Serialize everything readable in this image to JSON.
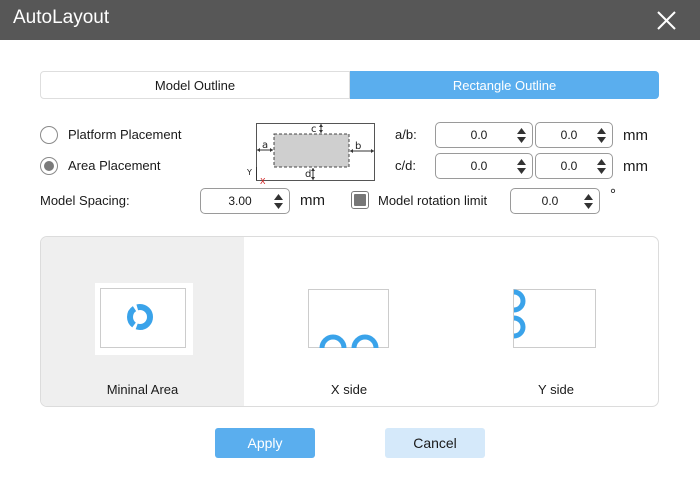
{
  "window": {
    "title": "AutoLayout"
  },
  "tabs": [
    {
      "label": "Model Outline",
      "selected": false
    },
    {
      "label": "Rectangle Outline",
      "selected": true
    }
  ],
  "placement": {
    "platform_label": "Platform Placement",
    "area_label": "Area Placement",
    "selected": "Area Placement"
  },
  "spacing": {
    "label": "Model Spacing:",
    "value": "3.00",
    "unit": "mm"
  },
  "rotation": {
    "label": "Model rotation limit",
    "value": "0.0",
    "unit": "°",
    "checked": true
  },
  "margins": {
    "ab_label": "a/b:",
    "cd_label": "c/d:",
    "a": "0.0",
    "b": "0.0",
    "c": "0.0",
    "d": "0.0",
    "unit": "mm"
  },
  "diagram": {
    "a": "a",
    "b": "b",
    "c": "c",
    "d": "d",
    "x_axis": "X",
    "y_axis": "Y"
  },
  "layout_options": [
    {
      "label": "Mininal Area",
      "selected": true
    },
    {
      "label": "X side",
      "selected": false
    },
    {
      "label": "Y side",
      "selected": false
    }
  ],
  "buttons": {
    "apply": "Apply",
    "cancel": "Cancel"
  },
  "colors": {
    "accent": "#5aaeee",
    "titlebar": "#575757",
    "cancel_bg": "#d5e9fa",
    "ring": "#3aa3ea"
  }
}
